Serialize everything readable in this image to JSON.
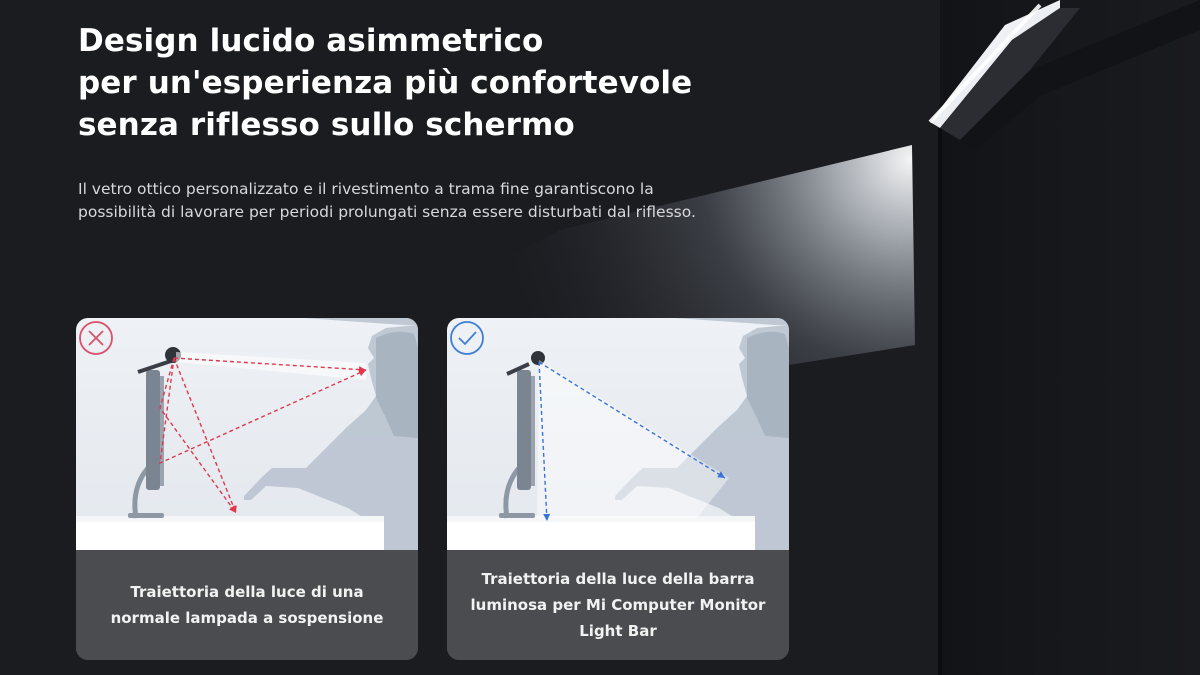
{
  "headline": {
    "line1": "Design lucido asimmetrico",
    "line2": "per un'esperienza più confortevole",
    "line3": "senza riflesso sullo schermo"
  },
  "description": {
    "line1": "Il vetro ottico personalizzato e il rivestimento a trama fine garantiscono la",
    "line2": "possibilità di lavorare per periodi prolungati senza essere disturbati dal riflesso."
  },
  "cards": [
    {
      "status_icon": "cross-circle-icon",
      "status_color": "#d9506a",
      "caption_line1": "Traiettoria della luce di una",
      "caption_line2": "normale lampada a sospensione",
      "caption_line3": "",
      "ray_color": "#e0384e"
    },
    {
      "status_icon": "check-circle-icon",
      "status_color": "#3d7fd6",
      "caption_line1": "Traiettoria della luce della barra",
      "caption_line2": "luminosa per Mi Computer Monitor",
      "caption_line3": "Light Bar",
      "ray_color": "#3a73d8"
    }
  ]
}
